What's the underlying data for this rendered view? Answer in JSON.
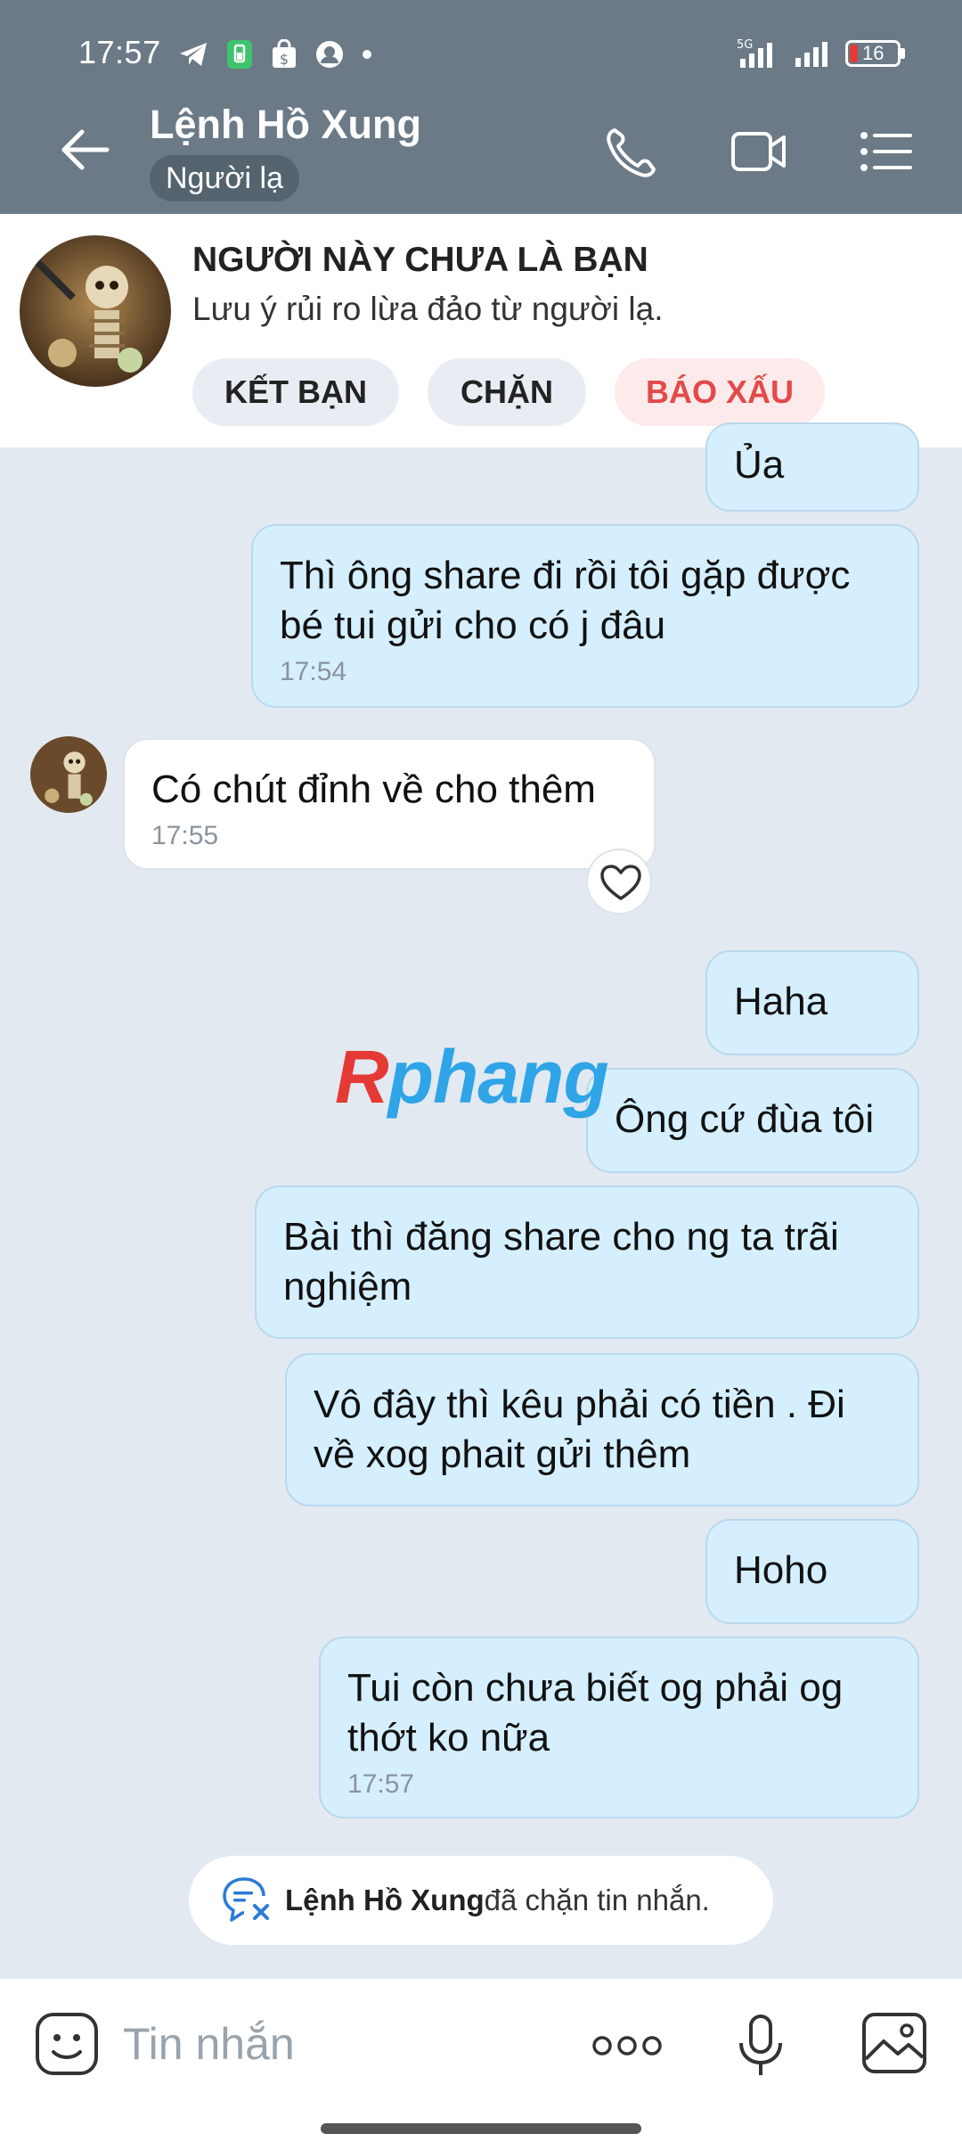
{
  "status_bar": {
    "time": "17:57",
    "network": "5G",
    "battery": "16"
  },
  "header": {
    "title": "Lệnh Hồ Xung",
    "subtitle": "Người lạ"
  },
  "stranger_card": {
    "title": "NGƯỜI NÀY CHƯA LÀ BẠN",
    "note": "Lưu ý rủi ro lừa đảo từ người lạ.",
    "add_friend": "KẾT BẠN",
    "block": "CHẶN",
    "report": "BÁO XẤU"
  },
  "messages": [
    {
      "from": "me",
      "text": "Ủa"
    },
    {
      "from": "me",
      "text": "Thì ông share đi rồi tôi gặp được bé tui gửi cho có j đâu",
      "time": "17:54"
    },
    {
      "from": "them",
      "text": "Có chút đỉnh về cho thêm",
      "time": "17:55"
    },
    {
      "from": "me",
      "text": "Haha"
    },
    {
      "from": "me",
      "text": "Ông cứ đùa tôi"
    },
    {
      "from": "me",
      "text": "Bài thì đăng share cho ng ta trãi nghiệm"
    },
    {
      "from": "me",
      "text": "Vô đây thì kêu phải có tiền . Đi về xog phait gửi thêm"
    },
    {
      "from": "me",
      "text": "Hoho"
    },
    {
      "from": "me",
      "text": "Tui còn chưa biết og phải og thớt ko nữa",
      "time": "17:57"
    }
  ],
  "watermark": {
    "r": "R",
    "rest": "phang"
  },
  "block_notice": {
    "name": "Lệnh Hồ Xung",
    "text": " đã chặn tin nhắn."
  },
  "input": {
    "placeholder": "Tin nhắn"
  },
  "colors": {
    "header": "#6b7a86",
    "my_bubble": "#d5efff",
    "chat_bg": "#e2e9f1",
    "danger": "#e34a4a"
  }
}
